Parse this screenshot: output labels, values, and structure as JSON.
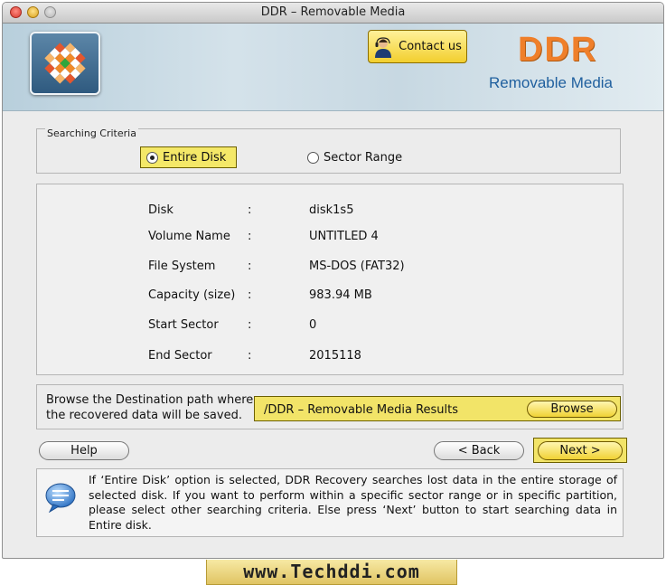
{
  "window": {
    "title": "DDR – Removable Media"
  },
  "banner": {
    "contact_label": "Contact us",
    "brand_name": "DDR",
    "brand_subtitle": "Removable Media"
  },
  "criteria": {
    "legend": "Searching Criteria",
    "options": [
      {
        "label": "Entire Disk",
        "selected": true
      },
      {
        "label": "Sector Range",
        "selected": false
      }
    ]
  },
  "disk_info": [
    {
      "label": "Disk",
      "value": "disk1s5"
    },
    {
      "label": "Volume Name",
      "value": "UNTITLED 4"
    },
    {
      "label": "File System",
      "value": "MS-DOS (FAT32)"
    },
    {
      "label": "Capacity (size)",
      "value": "983.94  MB"
    },
    {
      "label": "Start Sector",
      "value": "0"
    },
    {
      "label": "End Sector",
      "value": "2015118"
    }
  ],
  "separator": ":",
  "destination": {
    "prompt_line1": "Browse the Destination path where",
    "prompt_line2": "the recovered data will be saved.",
    "path": "/DDR – Removable Media Results",
    "browse_label": "Browse"
  },
  "nav": {
    "help_label": "Help",
    "back_label": "< Back",
    "next_label": "Next >"
  },
  "help_text": "If ‘Entire Disk’ option is selected, DDR Recovery searches lost data in the entire storage of selected disk. If you want to perform within a specific sector range or in specific partition, please select other searching criteria. Else press ‘Next’ button to start searching data in Entire disk.",
  "footer": {
    "url": "www.Techddi.com"
  },
  "colors": {
    "highlight": "#f2e468",
    "brand_orange": "#ef7f2a",
    "brand_blue": "#1f5f9e"
  }
}
